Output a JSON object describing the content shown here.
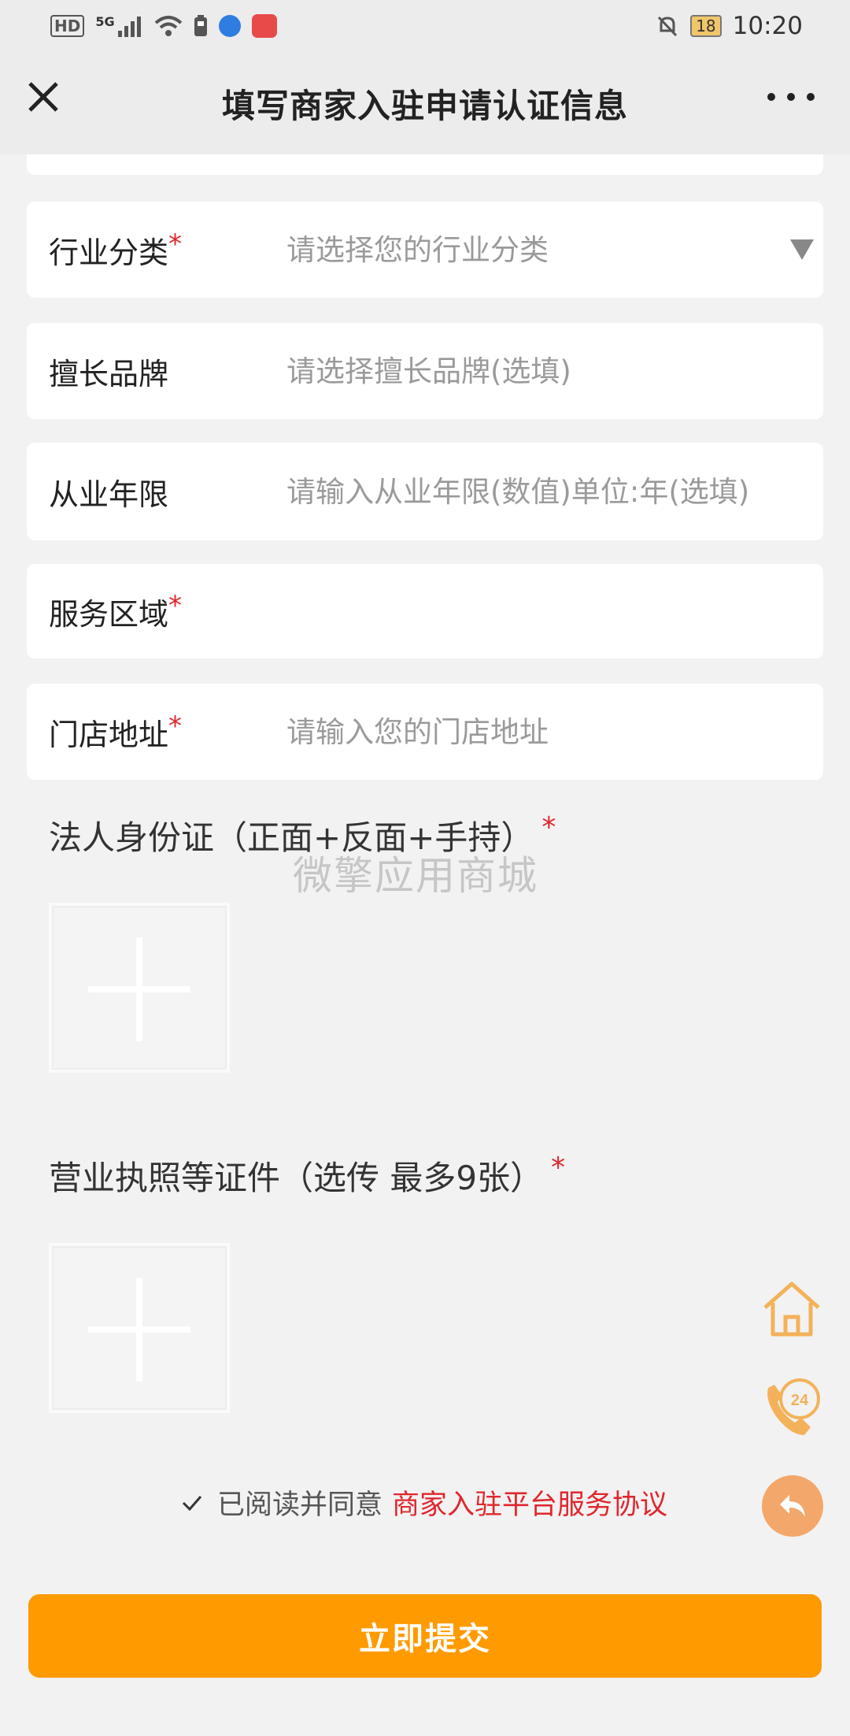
{
  "status_bar": {
    "hd_badge": "HD",
    "network": "5G",
    "battery": "18",
    "time": "10:20"
  },
  "nav": {
    "title": "填写商家入驻申请认证信息",
    "close_icon": "close-icon",
    "more_icon": "more-icon"
  },
  "fields": [
    {
      "label": "行业分类",
      "required": true,
      "placeholder": "请选择您的行业分类",
      "has_dropdown": true
    },
    {
      "label": "擅长品牌",
      "required": false,
      "placeholder": "请选择擅长品牌(选填)"
    },
    {
      "label": "从业年限",
      "required": false,
      "placeholder": "请输入从业年限(数值)单位:年(选填)"
    },
    {
      "label": "服务区域",
      "required": true,
      "placeholder": ""
    },
    {
      "label": "门店地址",
      "required": true,
      "placeholder": "请输入您的门店地址"
    }
  ],
  "required_mark": "*",
  "sections": {
    "id_card": {
      "title": "法人身份证（正面+反面+手持）"
    },
    "license": {
      "title": "营业执照等证件（选传 最多9张）"
    }
  },
  "watermark": "微擎应用商城",
  "agreement": {
    "checked": true,
    "text": "已阅读并同意",
    "link": "商家入驻平台服务协议"
  },
  "submit_label": "立即提交",
  "colors": {
    "accent": "#ff9a00",
    "required": "#e0262d",
    "fab": "#f3a76a"
  }
}
